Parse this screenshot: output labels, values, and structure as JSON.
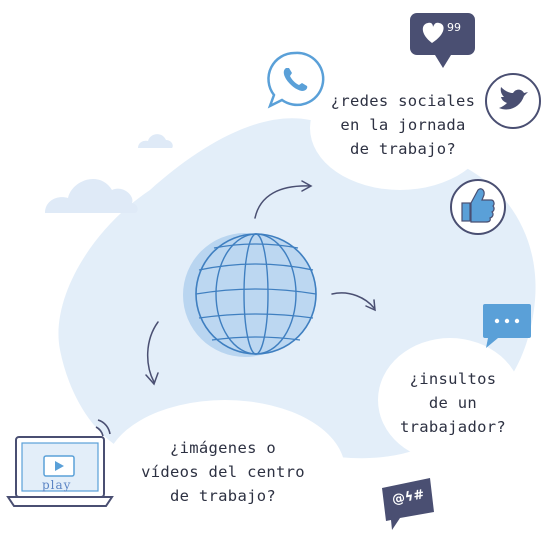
{
  "questions": {
    "social": [
      "¿redes sociales",
      "en la jornada",
      "de trabajo?"
    ],
    "insults": [
      "¿insultos",
      "de un",
      "trabajador?"
    ],
    "images": [
      "¿imágenes o",
      "vídeos del centro",
      "de trabajo?"
    ]
  },
  "icons": {
    "like_count": "99",
    "play_label": "play",
    "symbols": "@ϟ#"
  },
  "colors": {
    "blob": "#deebf8",
    "outline": "#4a4f72",
    "accent": "#5aa0d8",
    "globe": "#3f7fc0"
  }
}
